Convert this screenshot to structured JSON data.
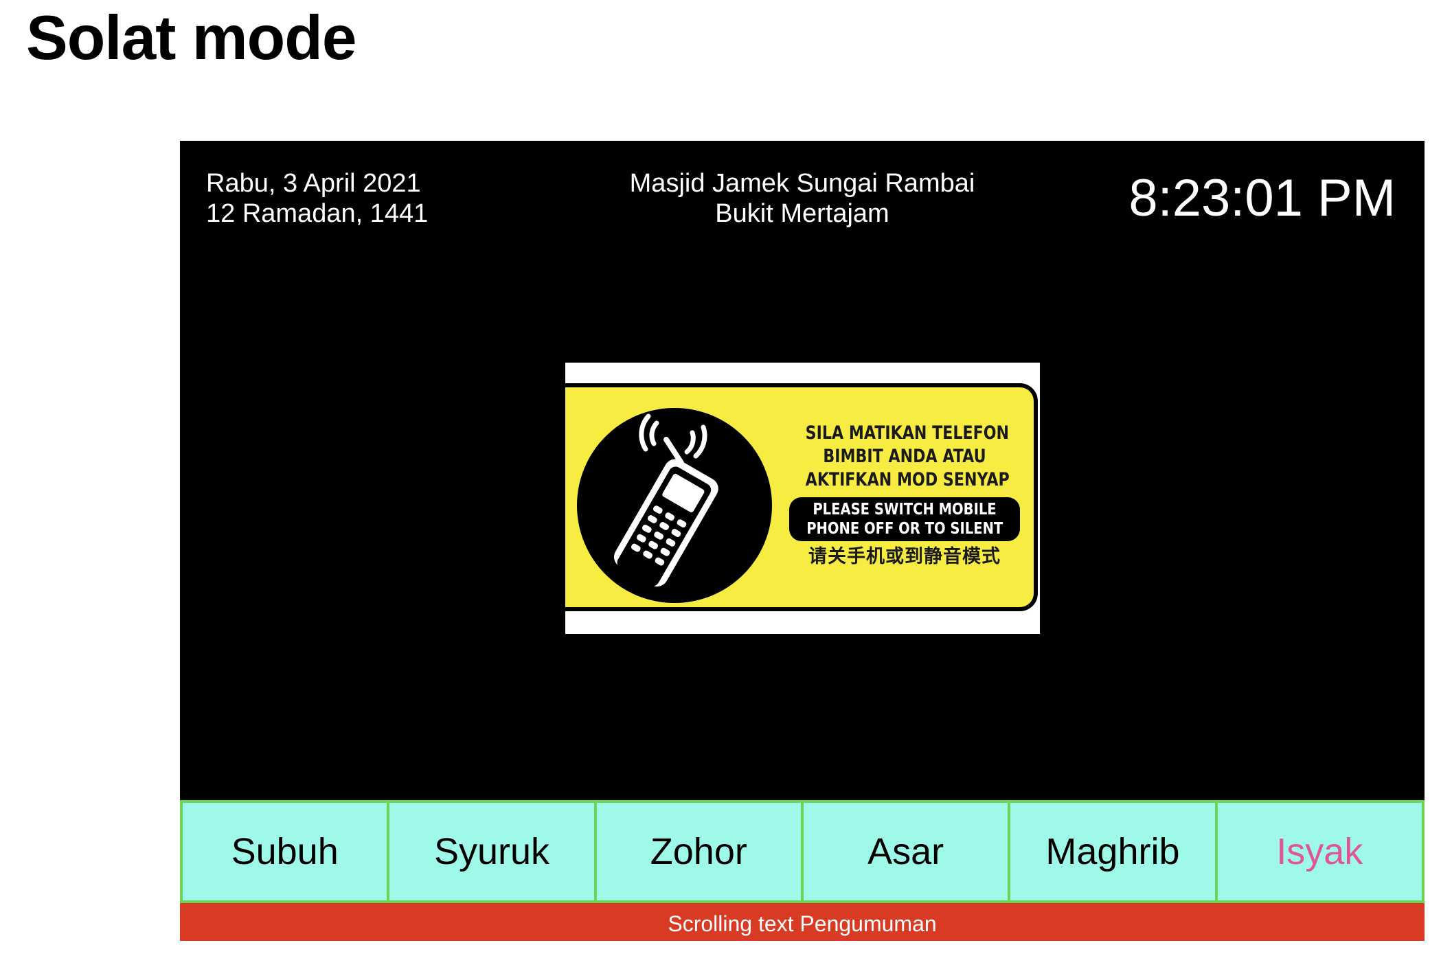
{
  "page": {
    "title": "Solat mode"
  },
  "display": {
    "gregorian_date": "Rabu, 3 April 2021",
    "hijri_date": "12 Ramadan, 1441",
    "mosque_name": "Masjid Jamek Sungai Rambai",
    "mosque_location": "Bukit Mertajam",
    "clock": "8:23:01 PM"
  },
  "notice": {
    "ms_line1": "SILA MATIKAN TELEFON",
    "ms_line2": "BIMBIT ANDA ATAU",
    "ms_line3": "AKTIFKAN MOD SENYAP",
    "en_line1": "PLEASE SWITCH MOBILE",
    "en_line2": "PHONE OFF OR TO SILENT",
    "zh_line": "请关手机或到静音模式",
    "icon": "mobile-phone-signal-icon"
  },
  "prayers": [
    {
      "name": "Subuh",
      "active": false
    },
    {
      "name": "Syuruk",
      "active": false
    },
    {
      "name": "Zohor",
      "active": false
    },
    {
      "name": "Asar",
      "active": false
    },
    {
      "name": "Maghrib",
      "active": false
    },
    {
      "name": "Isyak",
      "active": true
    }
  ],
  "ticker": {
    "text": "Scrolling text Pengumuman"
  },
  "colors": {
    "screen_bg": "#000000",
    "prayer_bar_bg": "#9ef9e8",
    "prayer_border": "#6cd456",
    "active_prayer": "#e0559a",
    "ticker_bg": "#d93a24",
    "notice_yellow": "#f7ec42"
  }
}
